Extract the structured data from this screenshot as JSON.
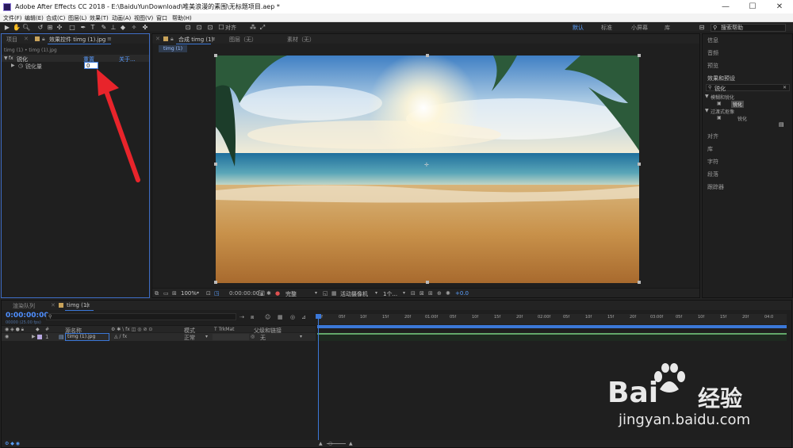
{
  "titlebar": {
    "title": "Adobe After Effects CC 2018 - E:\\BaiduYunDownload\\唯美浪漫的素围\\无标题项目.aep *",
    "minimize": "—",
    "maximize": "☐",
    "close": "✕"
  },
  "menu": [
    "文件(F)",
    "编辑(E)",
    "合成(C)",
    "图层(L)",
    "效果(T)",
    "动画(A)",
    "视图(V)",
    "窗口",
    "帮助(H)"
  ],
  "toolbar": {
    "align_label": "对齐",
    "workspaces": [
      "默认",
      "标准",
      "小屏幕",
      "库"
    ],
    "search_placeholder": "搜索帮助"
  },
  "left_panel": {
    "tabs": [
      "项目",
      "效果控件 timg (1).jpg"
    ],
    "menu_icon": "≡",
    "subtitle": "timg (1) • timg (1).jpg",
    "effect_name": "锐化",
    "reset_label": "重置",
    "about_label": "关于...",
    "prop_name": "锐化量",
    "prop_value": "0"
  },
  "comp_panel": {
    "tabs": [
      "合成 timg (1)",
      "图层（无）",
      "素材（无）"
    ],
    "subtab": "timg (1)",
    "controls": {
      "zoom": "100%",
      "time": "0:00:00:00",
      "resolution": "完整",
      "camera": "活动摄像机",
      "views": "1个...",
      "offset": "+0.0"
    }
  },
  "right_panel": {
    "items_top": [
      "信息",
      "音频",
      "预览",
      "效果和预设"
    ],
    "search_value": "锐化",
    "groups": [
      {
        "name": "模糊和锐化",
        "child": "锐化"
      },
      {
        "name": "过渡式抠像",
        "child": "锐化"
      }
    ],
    "items_bottom": [
      "对齐",
      "库",
      "字符",
      "段落",
      "跟踪器"
    ]
  },
  "timeline": {
    "tabs": [
      "渲染队列",
      "timg (1)"
    ],
    "timecode": "0:00:00:00",
    "fps": "00000 (25.00 fps)",
    "columns": {
      "name": "源名称",
      "mode": "模式",
      "trkmat": "T TrkMat",
      "parent": "父级和链接"
    },
    "layer": {
      "index": "1",
      "name": "timg (1).jpg",
      "mode": "正常",
      "parent": "无"
    },
    "ruler": [
      "0f",
      "05f",
      "10f",
      "15f",
      "20f",
      "01:00f",
      "05f",
      "10f",
      "15f",
      "20f",
      "02:00f",
      "05f",
      "10f",
      "15f",
      "20f",
      "03:00f",
      "05f",
      "10f",
      "15f",
      "20f",
      "04:0"
    ]
  },
  "watermark": {
    "brand": "Bai",
    "brand2": "经验",
    "url": "jingyan.baidu.com"
  },
  "colors": {
    "accent": "#3b78d8",
    "arrow": "#e8242b",
    "bg": "#232323"
  }
}
